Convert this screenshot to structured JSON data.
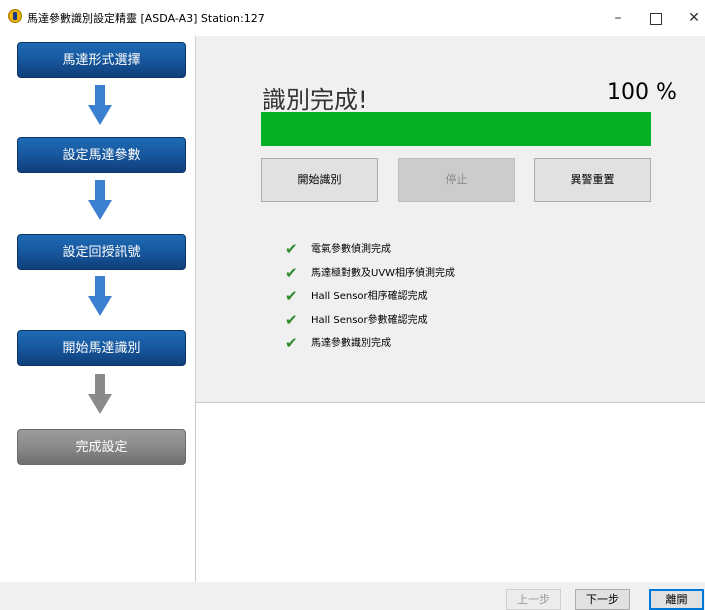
{
  "window": {
    "title": "馬達參數識別設定精靈 [ASDA-A3] Station:127",
    "icon": "delta-app-icon",
    "minimize": "–",
    "close": "✕"
  },
  "steps": [
    {
      "label": "馬達形式選擇",
      "state": "active"
    },
    {
      "label": "設定馬達參數",
      "state": "active"
    },
    {
      "label": "設定回授訊號",
      "state": "active"
    },
    {
      "label": "開始馬達識別",
      "state": "active"
    },
    {
      "label": "完成設定",
      "state": "inactive"
    }
  ],
  "identify": {
    "title": "識別完成!",
    "percent_text": "100 %",
    "progress": 1.0,
    "progress_color": "#06b025"
  },
  "controls": {
    "start": "開始識別",
    "stop": "停止",
    "reset": "異警重置"
  },
  "checklist": [
    "電氣參數偵測完成",
    "馬達極對數及UVW相序偵測完成",
    "Hall Sensor相序確認完成",
    "Hall Sensor參數確認完成",
    "馬達參數識別完成"
  ],
  "footer": {
    "prev": "上一步",
    "next": "下一步",
    "close": "離開"
  },
  "colors": {
    "step_active": "#1859a0",
    "step_inactive": "#8c8c8c",
    "arrow_active": "#3a7fd0",
    "arrow_inactive": "#8a8a8a",
    "check": "#2e8b2e"
  }
}
